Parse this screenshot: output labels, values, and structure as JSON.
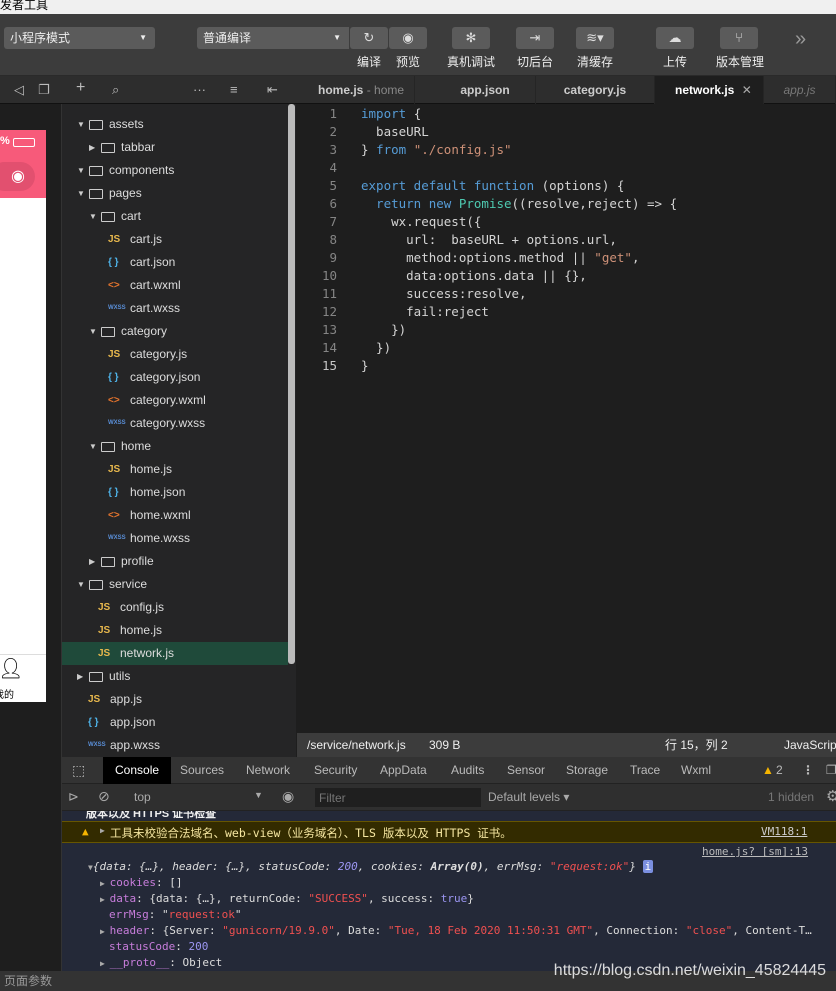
{
  "window": {
    "title": "开发者工具"
  },
  "toolbar": {
    "mode_select": "小程序模式",
    "compile_select": "普通编译",
    "buttons": [
      {
        "label": "编译",
        "icon": "refresh-icon"
      },
      {
        "label": "预览",
        "icon": "eye-icon"
      },
      {
        "label": "真机调试",
        "icon": "bug-icon"
      },
      {
        "label": "切后台",
        "icon": "switch-icon"
      },
      {
        "label": "清缓存",
        "icon": "layers-icon"
      },
      {
        "label": "上传",
        "icon": "cloud-upload-icon"
      },
      {
        "label": "版本管理",
        "icon": "branch-icon"
      }
    ],
    "more": "»"
  },
  "editor_tabs": [
    {
      "label": "home.js",
      "sub": "- home"
    },
    {
      "label": "app.json"
    },
    {
      "label": "category.js"
    },
    {
      "label": "network.js",
      "active": true
    },
    {
      "label": "app.js"
    }
  ],
  "tree": [
    {
      "label": "assets",
      "type": "folder",
      "open": true,
      "level": 0
    },
    {
      "label": "tabbar",
      "type": "folder",
      "open": false,
      "level": 1
    },
    {
      "label": "components",
      "type": "folder",
      "open": true,
      "level": 0
    },
    {
      "label": "pages",
      "type": "folder",
      "open": true,
      "level": 0
    },
    {
      "label": "cart",
      "type": "folder",
      "open": true,
      "level": 1
    },
    {
      "label": "cart.js",
      "type": "js",
      "level": 2
    },
    {
      "label": "cart.json",
      "type": "json",
      "level": 2
    },
    {
      "label": "cart.wxml",
      "type": "wxml",
      "level": 2
    },
    {
      "label": "cart.wxss",
      "type": "wxss",
      "level": 2
    },
    {
      "label": "category",
      "type": "folder",
      "open": true,
      "level": 1
    },
    {
      "label": "category.js",
      "type": "js",
      "level": 2
    },
    {
      "label": "category.json",
      "type": "json",
      "level": 2
    },
    {
      "label": "category.wxml",
      "type": "wxml",
      "level": 2
    },
    {
      "label": "category.wxss",
      "type": "wxss",
      "level": 2
    },
    {
      "label": "home",
      "type": "folder",
      "open": true,
      "level": 1
    },
    {
      "label": "home.js",
      "type": "js",
      "level": 2
    },
    {
      "label": "home.json",
      "type": "json",
      "level": 2
    },
    {
      "label": "home.wxml",
      "type": "wxml",
      "level": 2
    },
    {
      "label": "home.wxss",
      "type": "wxss",
      "level": 2
    },
    {
      "label": "profile",
      "type": "folder",
      "open": false,
      "level": 1
    },
    {
      "label": "service",
      "type": "folder",
      "open": true,
      "level": 0
    },
    {
      "label": "config.js",
      "type": "js",
      "level": 1
    },
    {
      "label": "home.js",
      "type": "js",
      "level": 1
    },
    {
      "label": "network.js",
      "type": "js",
      "level": 1,
      "selected": true
    },
    {
      "label": "utils",
      "type": "folder",
      "open": false,
      "level": 0
    },
    {
      "label": "app.js",
      "type": "js",
      "level": 0
    },
    {
      "label": "app.json",
      "type": "json",
      "level": 0
    },
    {
      "label": "app.wxss",
      "type": "wxss",
      "level": 0
    }
  ],
  "code": [
    [
      [
        "import ",
        "kw"
      ],
      [
        "{",
        ""
      ]
    ],
    [
      [
        "  baseURL",
        ""
      ]
    ],
    [
      [
        "} ",
        ""
      ],
      [
        "from ",
        "kw"
      ],
      [
        "\"./config.js\"",
        "str"
      ]
    ],
    [],
    [
      [
        "export default function ",
        "kw"
      ],
      [
        "(options) {",
        ""
      ]
    ],
    [
      [
        "  return new ",
        "kw"
      ],
      [
        "Promise",
        "cls"
      ],
      [
        "((resolve,reject) => {",
        ""
      ]
    ],
    [
      [
        "    wx.request({",
        ""
      ]
    ],
    [
      [
        "      url:  baseURL + options.url,",
        ""
      ]
    ],
    [
      [
        "      method:options.method || ",
        ""
      ],
      [
        "\"get\"",
        "str"
      ],
      [
        ",",
        ""
      ]
    ],
    [
      [
        "      data:options.data || {},",
        ""
      ]
    ],
    [
      [
        "      success:resolve,",
        ""
      ]
    ],
    [
      [
        "      fail:reject",
        ""
      ]
    ],
    [
      [
        "    })",
        ""
      ]
    ],
    [
      [
        "  })",
        ""
      ]
    ],
    [
      [
        "}",
        ""
      ]
    ]
  ],
  "status": {
    "path": "/service/network.js",
    "size": "309 B",
    "position": "行 15，列 2",
    "language": "JavaScript"
  },
  "simulator": {
    "battery": "%",
    "tab_label": "我的",
    "bottom": "页面参数"
  },
  "devtools": {
    "tabs": [
      "Console",
      "Sources",
      "Network",
      "Security",
      "AppData",
      "Audits",
      "Sensor",
      "Storage",
      "Trace",
      "Wxml"
    ],
    "warning_count": "2",
    "context": "top",
    "filter_placeholder": "Filter",
    "levels": "Default levels ▾",
    "hidden": "1 hidden",
    "cut_line": "版本以及 HTTPS 证书检查",
    "warning": "工具未校验合法域名、web-view（业务域名）、TLS 版本以及 HTTPS 证书。",
    "warning_src": "VM118:1",
    "log_src": "home.js? [sm]:13"
  },
  "watermark": "https://blog.csdn.net/weixin_45824445"
}
